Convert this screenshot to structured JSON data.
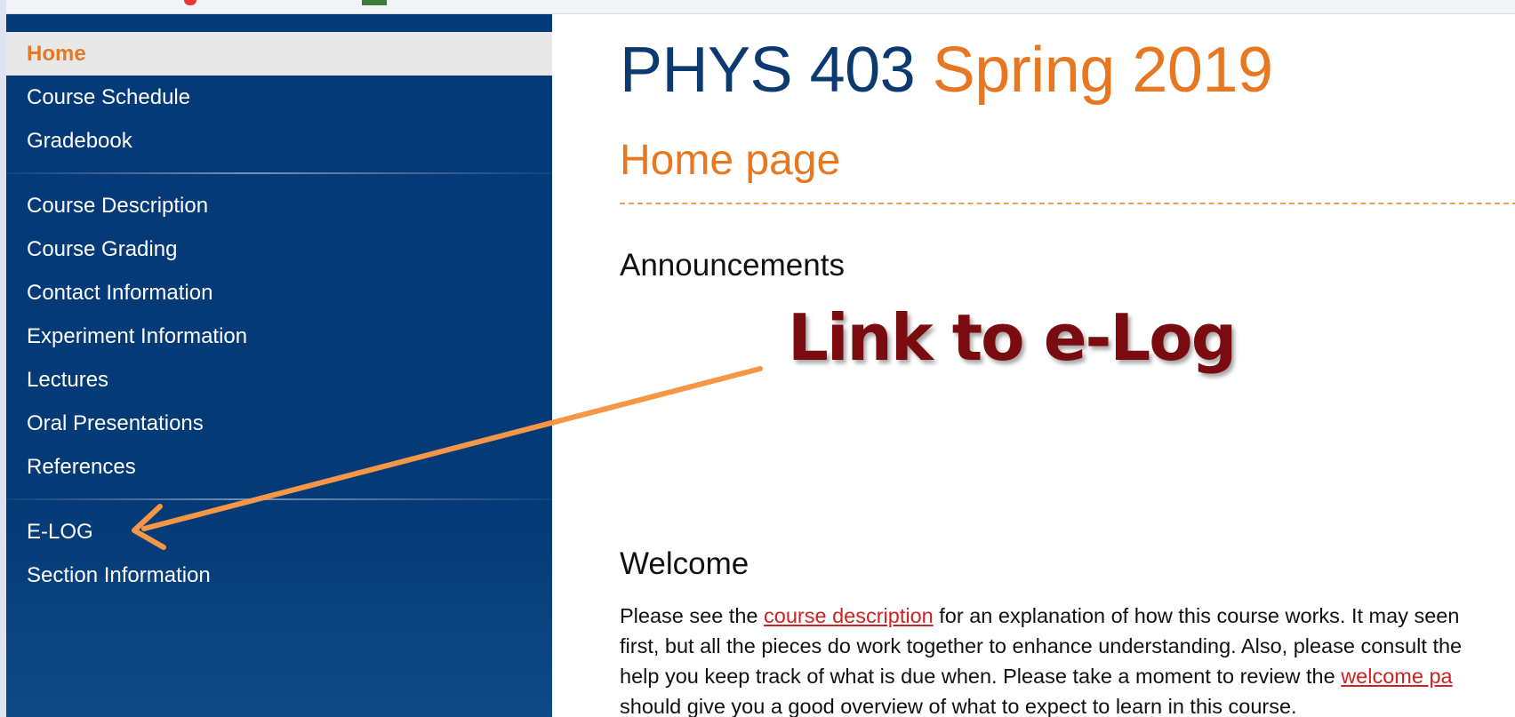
{
  "sidebar": {
    "groups": [
      [
        {
          "label": "Home",
          "active": true
        },
        {
          "label": "Course Schedule"
        },
        {
          "label": "Gradebook"
        }
      ],
      [
        {
          "label": "Course Description"
        },
        {
          "label": "Course Grading"
        },
        {
          "label": "Contact Information"
        },
        {
          "label": "Experiment Information"
        },
        {
          "label": "Lectures"
        },
        {
          "label": "Oral Presentations"
        },
        {
          "label": "References"
        }
      ],
      [
        {
          "label": "E-LOG"
        },
        {
          "label": "Section Information"
        }
      ]
    ]
  },
  "header": {
    "course": "PHYS 403",
    "term": "Spring 2019"
  },
  "main": {
    "section_title": "Home page",
    "announcements_heading": "Announcements",
    "welcome_heading": "Welcome",
    "welcome_paragraph": {
      "line1_before": "Please see the ",
      "line1_link": "course description",
      "line1_after": " for an explanation of how this course works. It may seen",
      "line2": "first, but all the pieces do work together to enhance understanding. Also, please consult the",
      "line3_before": "help you keep track of what is due when. Please take a moment to review the ",
      "line3_link": "welcome pa",
      "line4": "should give you a good overview of what to expect to learn in this course."
    }
  },
  "annotation": {
    "callout_text": "Link to e-Log"
  },
  "colors": {
    "sidebar_bg": "#043a78",
    "accent_orange": "#e87722",
    "title_navy": "#0a3a70",
    "callout_red": "#7a0c10",
    "arrow_orange": "#f79646",
    "link_red": "#cc2222"
  }
}
